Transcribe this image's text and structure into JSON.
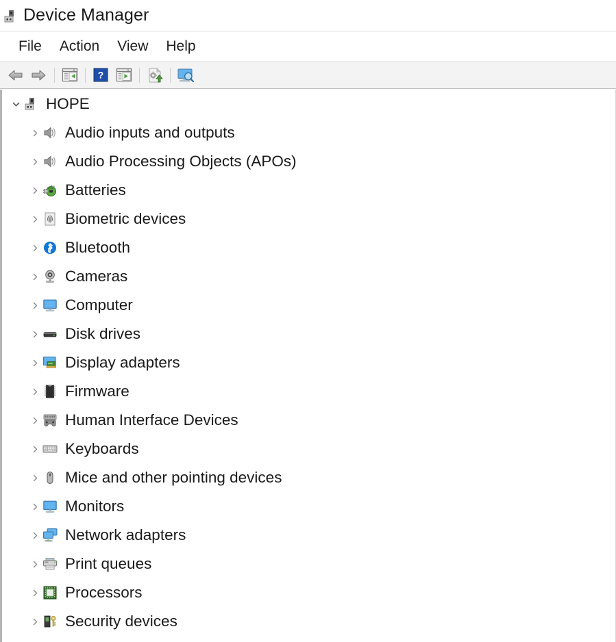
{
  "window": {
    "title": "Device Manager",
    "title_icon": "device-manager-icon"
  },
  "menubar": {
    "items": [
      {
        "label": "File",
        "name": "menu-file"
      },
      {
        "label": "Action",
        "name": "menu-action"
      },
      {
        "label": "View",
        "name": "menu-view"
      },
      {
        "label": "Help",
        "name": "menu-help"
      }
    ]
  },
  "toolbar": {
    "buttons": [
      {
        "icon": "back-arrow-icon",
        "name": "toolbar-back-button"
      },
      {
        "icon": "forward-arrow-icon",
        "name": "toolbar-forward-button"
      },
      {
        "icon": "show-hide-console-tree-icon",
        "name": "toolbar-show-hide-console-tree-button"
      },
      {
        "icon": "help-icon",
        "name": "toolbar-help-button"
      },
      {
        "icon": "properties-icon",
        "name": "toolbar-properties-button"
      },
      {
        "icon": "update-driver-icon",
        "name": "toolbar-update-driver-button"
      },
      {
        "icon": "scan-for-hardware-changes-icon",
        "name": "toolbar-scan-hardware-button"
      }
    ]
  },
  "tree": {
    "root": {
      "label": "HOPE",
      "icon": "computer-node-icon",
      "expanded": true,
      "chevron": "chevron-down"
    },
    "items": [
      {
        "label": "Audio inputs and outputs",
        "icon": "speaker-icon",
        "chevron": "chevron-right"
      },
      {
        "label": "Audio Processing Objects (APOs)",
        "icon": "speaker-icon",
        "chevron": "chevron-right"
      },
      {
        "label": "Batteries",
        "icon": "battery-icon",
        "chevron": "chevron-right"
      },
      {
        "label": "Biometric devices",
        "icon": "fingerprint-icon",
        "chevron": "chevron-right"
      },
      {
        "label": "Bluetooth",
        "icon": "bluetooth-icon",
        "chevron": "chevron-right"
      },
      {
        "label": "Cameras",
        "icon": "camera-icon",
        "chevron": "chevron-right"
      },
      {
        "label": "Computer",
        "icon": "monitor-icon",
        "chevron": "chevron-right"
      },
      {
        "label": "Disk drives",
        "icon": "disk-drive-icon",
        "chevron": "chevron-right"
      },
      {
        "label": "Display adapters",
        "icon": "display-adapter-icon",
        "chevron": "chevron-right"
      },
      {
        "label": "Firmware",
        "icon": "firmware-chip-icon",
        "chevron": "chevron-right"
      },
      {
        "label": "Human Interface Devices",
        "icon": "hid-gamepad-icon",
        "chevron": "chevron-right"
      },
      {
        "label": "Keyboards",
        "icon": "keyboard-icon",
        "chevron": "chevron-right"
      },
      {
        "label": "Mice and other pointing devices",
        "icon": "mouse-icon",
        "chevron": "chevron-right"
      },
      {
        "label": "Monitors",
        "icon": "monitor-icon",
        "chevron": "chevron-right"
      },
      {
        "label": "Network adapters",
        "icon": "network-adapter-icon",
        "chevron": "chevron-right"
      },
      {
        "label": "Print queues",
        "icon": "printer-icon",
        "chevron": "chevron-right"
      },
      {
        "label": "Processors",
        "icon": "processor-icon",
        "chevron": "chevron-right"
      },
      {
        "label": "Security devices",
        "icon": "security-device-icon",
        "chevron": "chevron-right"
      }
    ]
  },
  "colors": {
    "accent_blue": "#2a8fe0",
    "bluetooth_blue": "#1277d4",
    "toolbar_bg": "#f3f3f3",
    "text": "#1a1a1a",
    "chevron": "#6b6b6b",
    "help_blue": "#1f4fa8",
    "green": "#4a9b3a"
  }
}
